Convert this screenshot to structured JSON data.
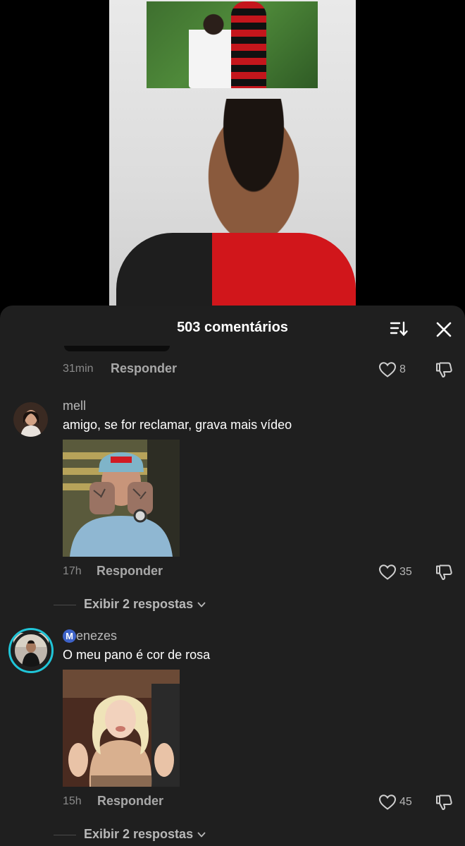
{
  "sheet": {
    "title": "503 comentários"
  },
  "previous_comment": {
    "time": "31min",
    "reply_label": "Responder",
    "likes": "8"
  },
  "comments": [
    {
      "username": "mell",
      "text": "amigo, se for reclamar, grava mais vídeo",
      "time": "17h",
      "reply_label": "Responder",
      "likes": "35",
      "replies_label": "Exibir 2 respostas"
    },
    {
      "username_badge": "M",
      "username": "enezes",
      "text": "O meu pano é cor de rosa",
      "time": "15h",
      "reply_label": "Responder",
      "likes": "45",
      "replies_label": "Exibir 2 respostas"
    }
  ],
  "icons": {
    "sort": "sort-icon",
    "close": "close-icon",
    "like": "heart-icon",
    "dislike": "thumbs-down-icon",
    "chevron": "chevron-down-icon"
  },
  "colors": {
    "sheet_bg": "#1f1f1f",
    "story_ring": "#20c5d8"
  }
}
